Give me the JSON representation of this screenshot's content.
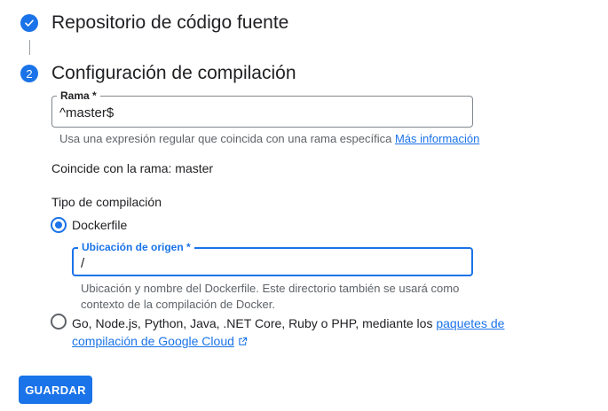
{
  "steps": [
    {
      "number": "",
      "title": "Repositorio de código fuente",
      "status": "completed"
    },
    {
      "number": "2",
      "title": "Configuración de compilación",
      "status": "active"
    }
  ],
  "branch_field": {
    "label": "Rama *",
    "value": "^master$",
    "hint": "Usa una expresión regular que coincida con una rama específica",
    "hint_link": "Más información"
  },
  "match_text": "Coincide con la rama: master",
  "build_type": {
    "heading": "Tipo de compilación",
    "option_dockerfile": "Dockerfile",
    "source_field": {
      "label": "Ubicación de origen *",
      "value": "/",
      "hint_line1": "Ubicación y nombre del Dockerfile. Este directorio también se usará como",
      "hint_line2": "contexto de la compilación de Docker."
    },
    "option_buildpacks_text": "Go, Node.js, Python, Java, .NET Core, Ruby o PHP, mediante los",
    "option_buildpacks_link1": "paquetes de",
    "option_buildpacks_link2": "compilación de Google Cloud"
  },
  "save_button": "GUARDAR",
  "colors": {
    "accent": "#1a73e8",
    "text": "#202124",
    "secondary_text": "#5f6368"
  },
  "icons": [
    "check-icon",
    "external-link-icon"
  ]
}
